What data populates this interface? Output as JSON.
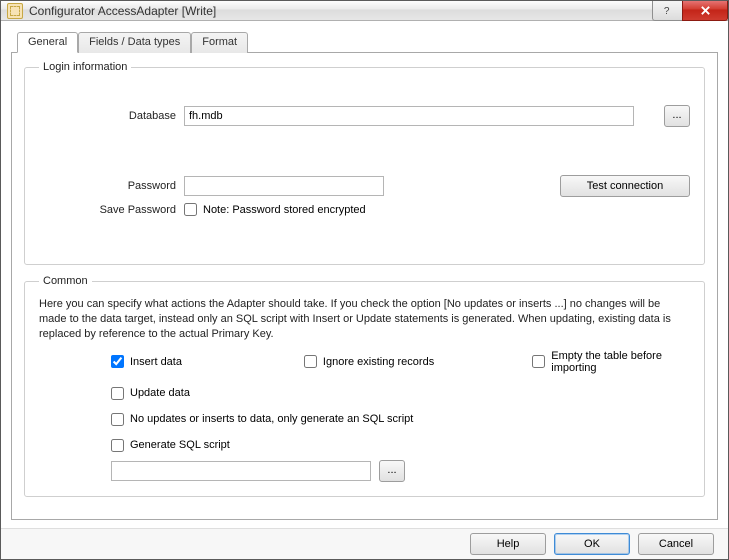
{
  "window": {
    "title": "Configurator AccessAdapter [Write]"
  },
  "tabs": {
    "general": "General",
    "fields": "Fields / Data types",
    "format": "Format"
  },
  "login": {
    "legend": "Login information",
    "database_label": "Database",
    "database_value": "fh.mdb",
    "browse_label": "...",
    "password_label": "Password",
    "password_value": "",
    "save_password_label": "Save Password",
    "save_password_note": "Note: Password stored encrypted",
    "test_connection_label": "Test connection"
  },
  "common": {
    "legend": "Common",
    "description": "Here you can specify what actions the Adapter should take. If you check the option [No updates or inserts ...] no changes will be made to the data target, instead only an SQL script with Insert or Update statements is generated. When updating, existing data is replaced by reference to the actual Primary Key.",
    "insert_label": "Insert data",
    "ignore_label": "Ignore existing records",
    "empty_label": "Empty the table before importing",
    "update_label": "Update data",
    "noupd_label": "No updates or inserts to data, only generate an SQL script",
    "generate_label": "Generate SQL script",
    "sql_value": "",
    "sql_browse_label": "..."
  },
  "footer": {
    "help": "Help",
    "ok": "OK",
    "cancel": "Cancel"
  }
}
